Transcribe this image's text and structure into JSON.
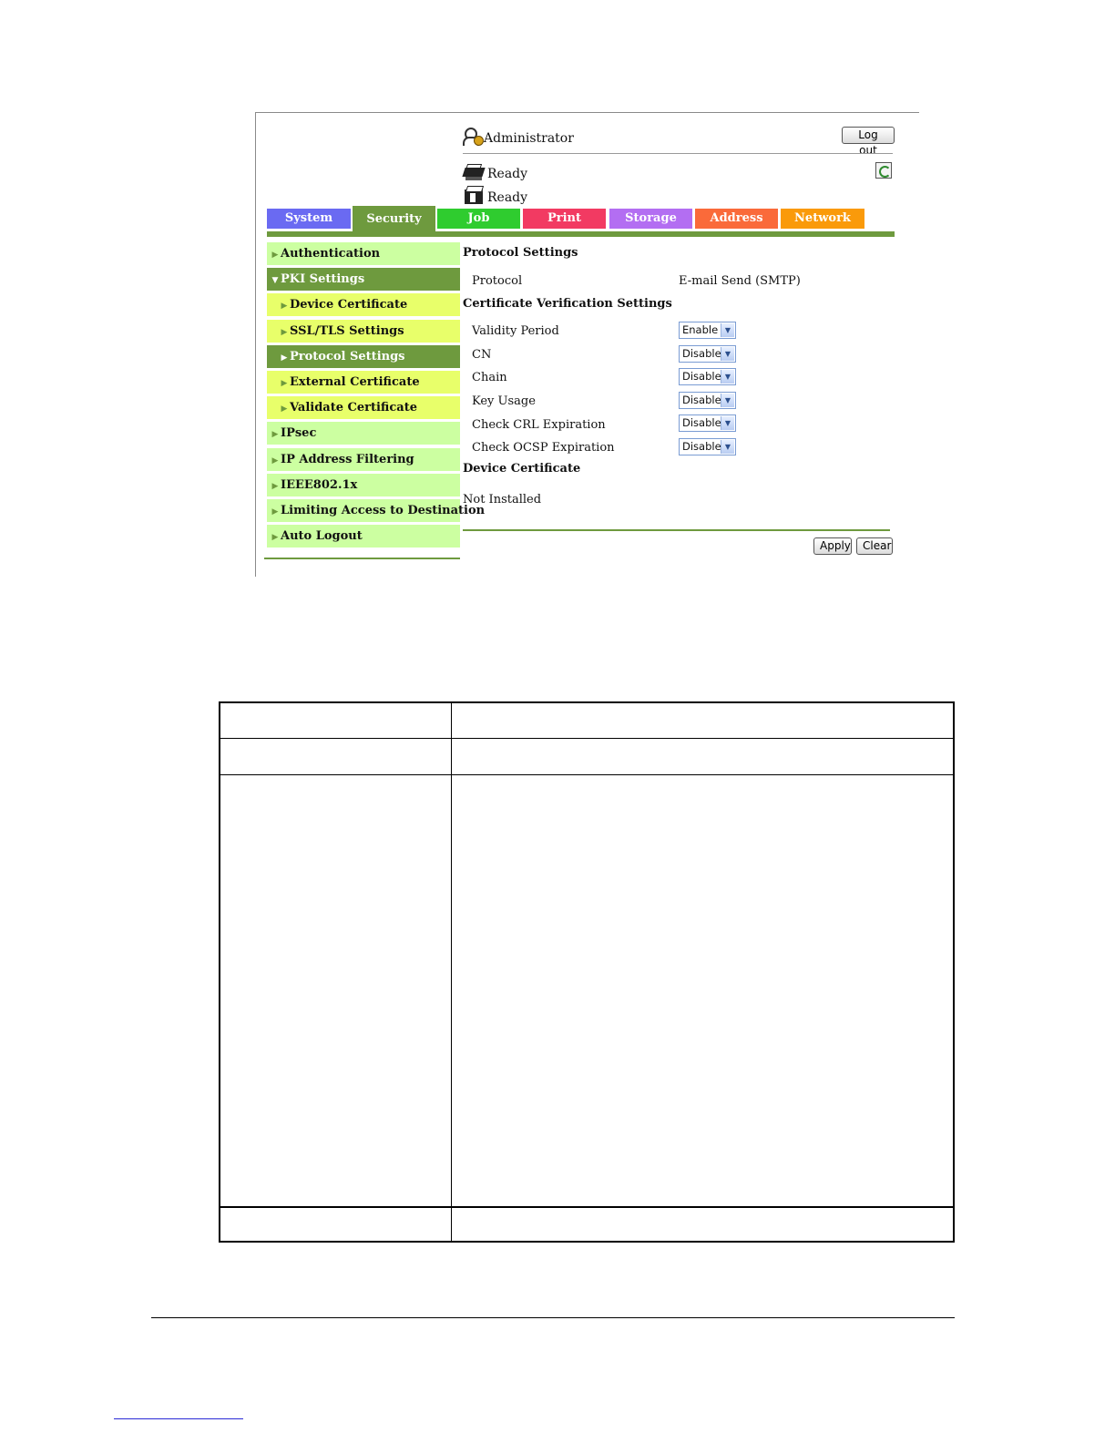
{
  "header": {
    "user_label": "Administrator",
    "logout_label": "Log out",
    "status": [
      "Ready",
      "Ready"
    ],
    "icons": [
      "administrator-icon",
      "printer-icon",
      "scanner-icon",
      "refresh-icon"
    ]
  },
  "tabs": [
    {
      "label": "System",
      "color": "#6a6af2"
    },
    {
      "label": "Security",
      "color": "#6e9a3e"
    },
    {
      "label": "Job",
      "color": "#2fcc2f"
    },
    {
      "label": "Print",
      "color": "#f23a62"
    },
    {
      "label": "Storage",
      "color": "#b36ef2"
    },
    {
      "label": "Address",
      "color": "#fa6a3a"
    },
    {
      "label": "Network",
      "color": "#fa9a0a"
    }
  ],
  "sidebar": {
    "items": [
      {
        "label": "Authentication"
      },
      {
        "label": "PKI Settings"
      },
      {
        "label": "Device Certificate"
      },
      {
        "label": "SSL/TLS Settings"
      },
      {
        "label": "Protocol Settings"
      },
      {
        "label": "External Certificate"
      },
      {
        "label": "Validate Certificate"
      },
      {
        "label": "IPsec"
      },
      {
        "label": "IP Address Filtering"
      },
      {
        "label": "IEEE802.1x"
      },
      {
        "label": "Limiting Access to Destination"
      },
      {
        "label": "Auto Logout"
      }
    ]
  },
  "main": {
    "title": "Protocol Settings",
    "protocol_label": "Protocol",
    "protocol_value": "E-mail Send (SMTP)",
    "cert_verification_title": "Certificate Verification Settings",
    "settings": [
      {
        "label": "Validity Period",
        "value": "Enable"
      },
      {
        "label": "CN",
        "value": "Disable"
      },
      {
        "label": "Chain",
        "value": "Disable"
      },
      {
        "label": "Key Usage",
        "value": "Disable"
      },
      {
        "label": "Check CRL Expiration",
        "value": "Disable"
      },
      {
        "label": "Check OCSP Expiration",
        "value": "Disable"
      }
    ],
    "device_cert_title": "Device Certificate",
    "device_cert_status": "Not Installed",
    "apply_label": "Apply",
    "clear_label": "Clear"
  },
  "colors": {
    "accent_green": "#6e9a3e",
    "sidebar_light": "#ccffa1",
    "sidebar_sub": "#e8ff6a"
  }
}
